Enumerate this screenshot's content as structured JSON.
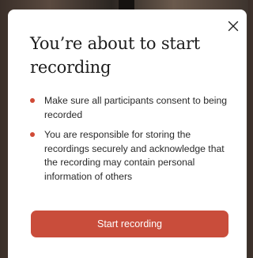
{
  "dialog": {
    "title": "You’re about to start recording",
    "close_icon": "close-icon",
    "points": [
      "Make sure all participants consent to being recorded",
      "You are responsible for storing the recordings securely and acknowledge that the recording may contain personal information of others"
    ],
    "primary_button": "Start recording"
  },
  "colors": {
    "accent": "#c94d3b",
    "bullet": "#d04a36",
    "text": "#1d1d1d",
    "background": "#ffffff"
  }
}
